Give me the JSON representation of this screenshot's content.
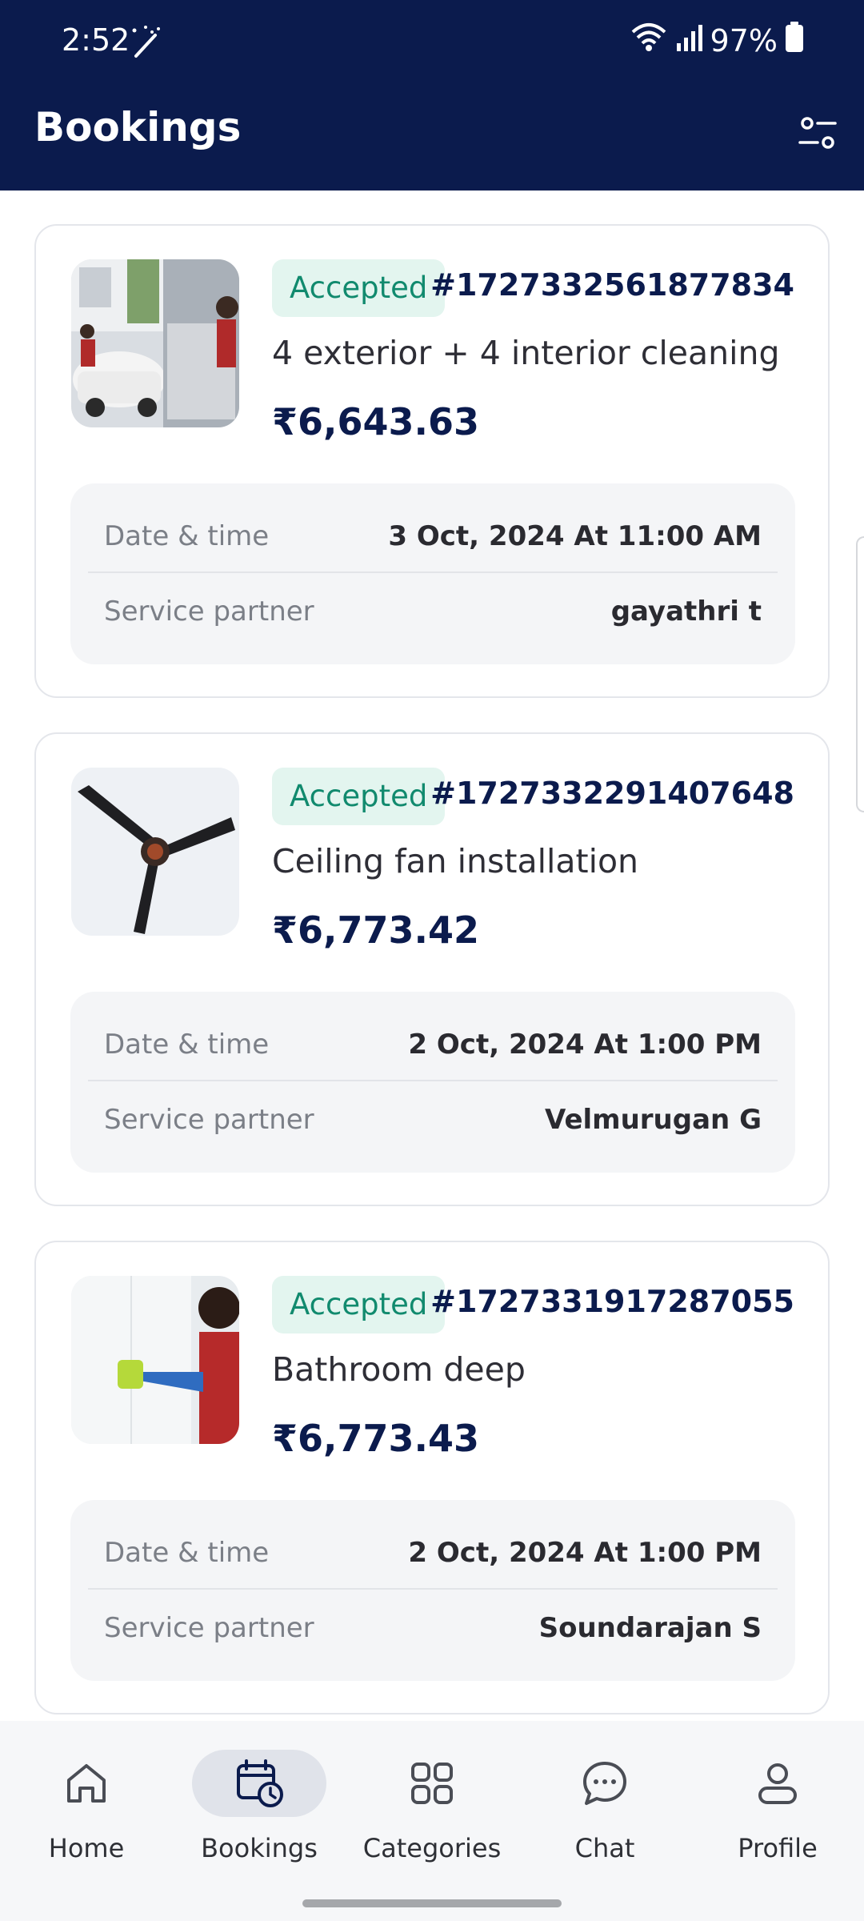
{
  "status_bar": {
    "time": "2:52",
    "battery": "97%"
  },
  "header": {
    "title": "Bookings"
  },
  "bookings": [
    {
      "status": "Accepted",
      "order_id": "#1727332561877834",
      "service": "4 exterior + 4 interior cleaning",
      "price": "₹6,643.63",
      "date_label": "Date & time",
      "date_value": "3 Oct, 2024 At 11:00 AM",
      "partner_label": "Service partner",
      "partner_value": "gayathri t"
    },
    {
      "status": "Accepted",
      "order_id": "#1727332291407648",
      "service": "Ceiling fan installation",
      "price": "₹6,773.42",
      "date_label": "Date & time",
      "date_value": "2 Oct, 2024 At 1:00 PM",
      "partner_label": "Service partner",
      "partner_value": "Velmurugan G"
    },
    {
      "status": "Accepted",
      "order_id": "#1727331917287055",
      "service": "Bathroom deep",
      "price": "₹6,773.43",
      "date_label": "Date & time",
      "date_value": "2 Oct, 2024 At 1:00 PM",
      "partner_label": "Service partner",
      "partner_value": "Soundarajan S"
    }
  ],
  "nav": {
    "items": [
      {
        "label": "Home",
        "icon": "home-icon"
      },
      {
        "label": "Bookings",
        "icon": "calendar-clock-icon",
        "active": true
      },
      {
        "label": "Categories",
        "icon": "grid-icon"
      },
      {
        "label": "Chat",
        "icon": "chat-icon"
      },
      {
        "label": "Profile",
        "icon": "profile-icon"
      }
    ]
  },
  "colors": {
    "primary": "#0b1b4d",
    "accepted_bg": "#e3f5ef",
    "accepted_text": "#118a6e"
  }
}
